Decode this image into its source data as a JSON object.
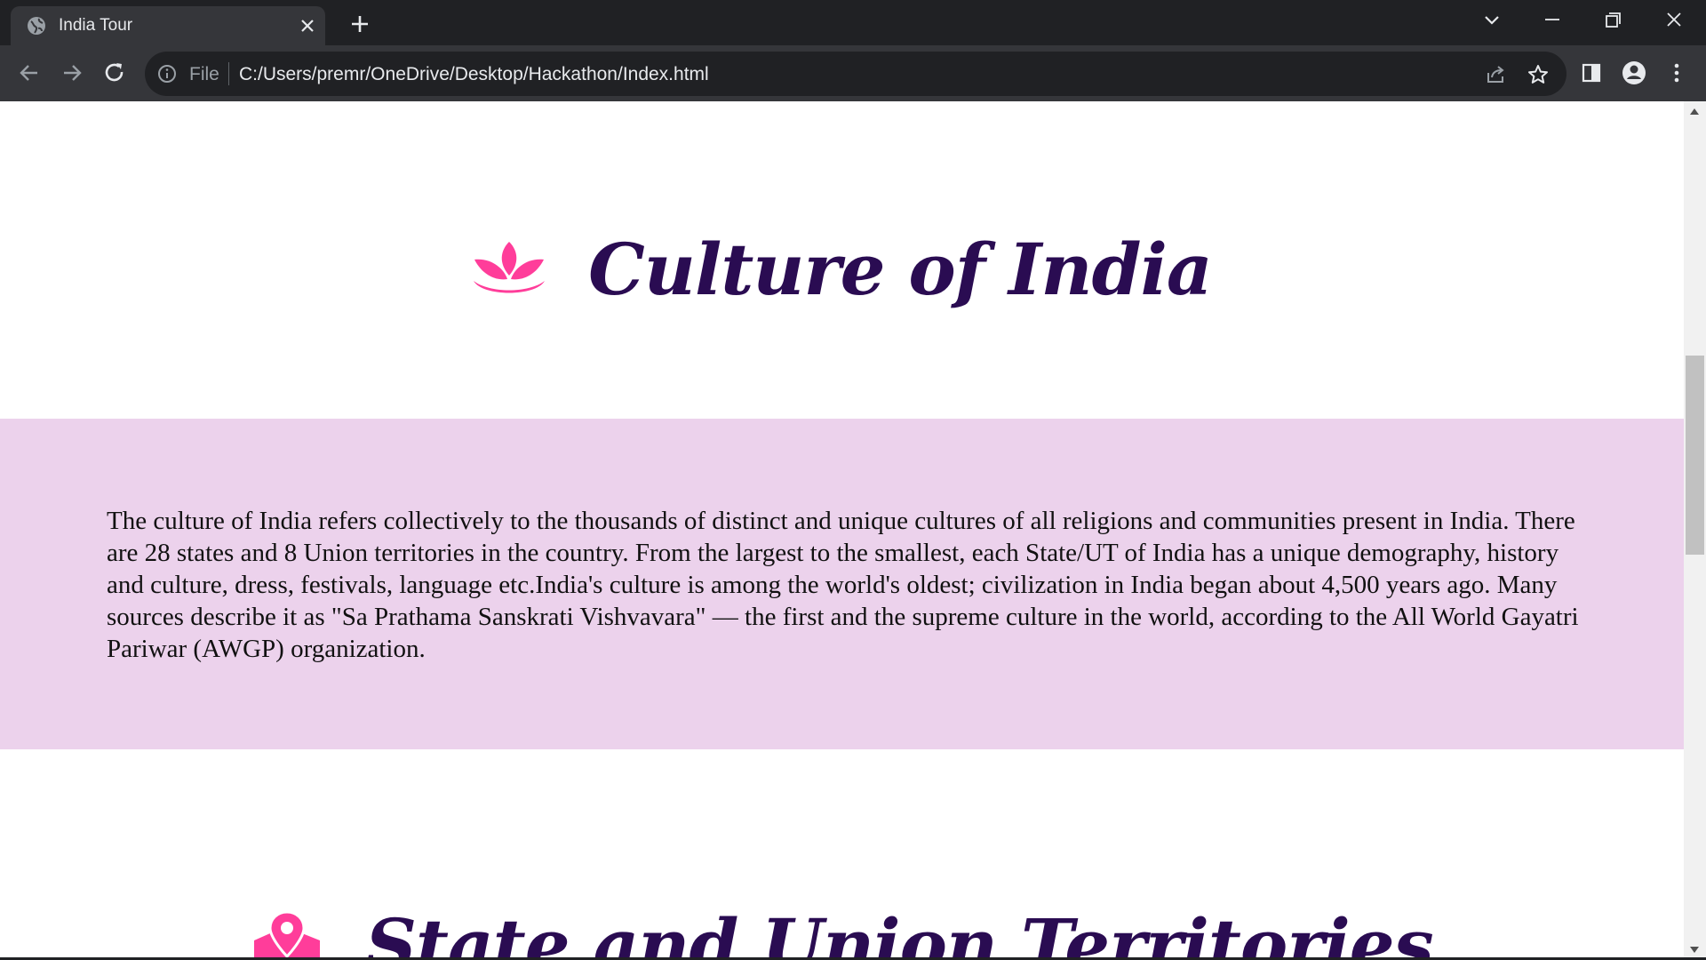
{
  "browser": {
    "tab": {
      "title": "India Tour"
    },
    "omnibox": {
      "scheme_label": "File",
      "url": "C:/Users/premr/OneDrive/Desktop/Hackathon/Index.html"
    }
  },
  "page": {
    "culture_section": {
      "heading": "Culture of India",
      "heading_icon": "lotus-icon",
      "paragraph": "The culture of India refers collectively to the thousands of distinct and unique cultures of all religions and communities present in India. There are 28 states and 8 Union territories in the country. From the largest to the smallest, each State/UT of India has a unique demography, history and culture, dress, festivals, language etc.India's culture is among the world's oldest; civilization in India began about 4,500 years ago. Many sources describe it as \"Sa Prathama Sanskrati Vishvavara\" — the first and the supreme culture in the world, according to the All World Gayatri Pariwar (AWGP) organization."
    },
    "states_section": {
      "heading": "State and Union Territories",
      "heading_icon": "map-pin-icon"
    }
  },
  "colors": {
    "heading": "#2a0c52",
    "accent_pink": "#ff3d9a",
    "band_background": "#ecd2ec"
  }
}
